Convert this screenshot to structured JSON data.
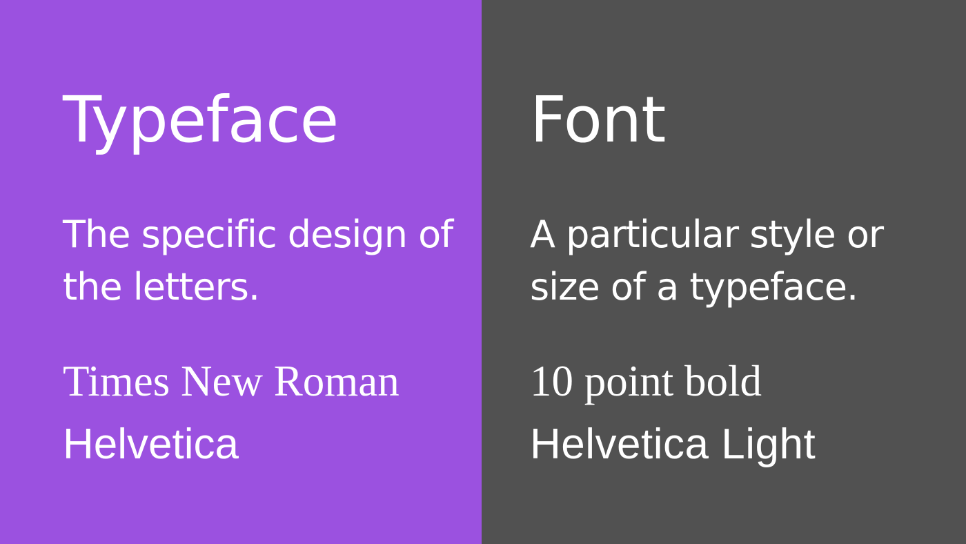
{
  "left": {
    "title": "Typeface",
    "description": "The specific design of the letters.",
    "example_1": "Times New Roman",
    "example_2": "Helvetica",
    "background": "#9b51e0"
  },
  "right": {
    "title": "Font",
    "description": "A particular style or size of a typeface.",
    "example_1": "10 point bold",
    "example_2": "Helvetica Light",
    "background": "#515151"
  }
}
